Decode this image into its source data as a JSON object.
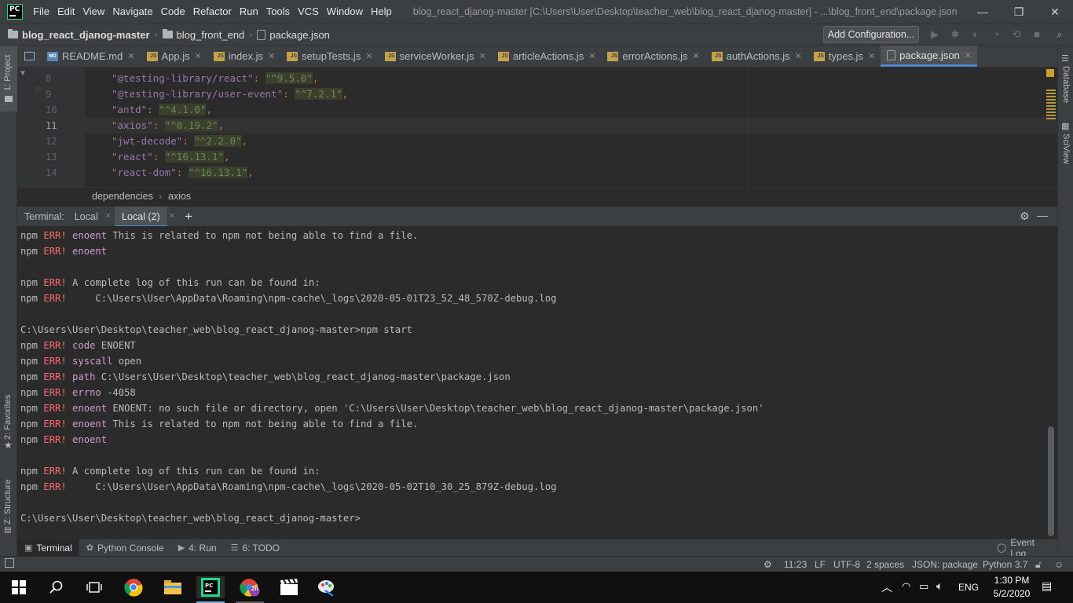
{
  "titlebar": {
    "menu": [
      "File",
      "Edit",
      "View",
      "Navigate",
      "Code",
      "Refactor",
      "Run",
      "Tools",
      "VCS",
      "Window",
      "Help"
    ],
    "window_title": "blog_react_djanog-master [C:\\Users\\User\\Desktop\\teacher_web\\blog_react_djanog-master] - ...\\blog_front_end\\package.json",
    "controls": {
      "minimize": "—",
      "restore": "❐",
      "close": "✕"
    }
  },
  "navbar": {
    "project": "blog_react_djanog-master",
    "folder": "blog_front_end",
    "file": "package.json",
    "add_config": "Add Configuration..."
  },
  "tabs": [
    {
      "label": "README.md",
      "icon": "md"
    },
    {
      "label": "App.js",
      "icon": "js"
    },
    {
      "label": "index.js",
      "icon": "js"
    },
    {
      "label": "setupTests.js",
      "icon": "js"
    },
    {
      "label": "serviceWorker.js",
      "icon": "js"
    },
    {
      "label": "articleActions.js",
      "icon": "js"
    },
    {
      "label": "errorActions.js",
      "icon": "js"
    },
    {
      "label": "authActions.js",
      "icon": "js"
    },
    {
      "label": "types.js",
      "icon": "js"
    },
    {
      "label": "package.json",
      "icon": "json",
      "active": true
    }
  ],
  "left_strip": {
    "project": "1: Project",
    "favorites": "2: Favorites",
    "structure": "Z: Structure"
  },
  "right_strip": {
    "database": "Database",
    "sciview": "SciView"
  },
  "editor": {
    "lines": [
      {
        "n": "8",
        "key": "\"@testing-library/react\"",
        "val": "\"^9.5.0\""
      },
      {
        "n": "9",
        "key": "\"@testing-library/user-event\"",
        "val": "\"^7.2.1\""
      },
      {
        "n": "10",
        "key": "\"antd\"",
        "val": "\"^4.1.0\""
      },
      {
        "n": "11",
        "key": "\"axios\"",
        "val": "\"^0.19.2\""
      },
      {
        "n": "12",
        "key": "\"jwt-decode\"",
        "val": "\"^2.2.0\""
      },
      {
        "n": "13",
        "key": "\"react\"",
        "val": "\"^16.13.1\""
      },
      {
        "n": "14",
        "key": "\"react-dom\"",
        "val": "\"^16.13.1\""
      }
    ],
    "breadcrumb": [
      "dependencies",
      "axios"
    ]
  },
  "terminal": {
    "label": "Terminal:",
    "tabs": [
      "Local",
      "Local (2)"
    ],
    "add": "+",
    "lines": [
      {
        "p": "npm ",
        "e": "ERR!",
        "k": " enoent",
        "r": " This is related to npm not being able to find a file."
      },
      {
        "p": "npm ",
        "e": "ERR!",
        "k": " enoent",
        "r": ""
      },
      {
        "p": "",
        "e": "",
        "k": "",
        "r": ""
      },
      {
        "p": "npm ",
        "e": "ERR!",
        "k": "",
        "r": " A complete log of this run can be found in:"
      },
      {
        "p": "npm ",
        "e": "ERR!",
        "k": "",
        "r": "     C:\\Users\\User\\AppData\\Roaming\\npm-cache\\_logs\\2020-05-01T23_52_48_570Z-debug.log"
      },
      {
        "p": "",
        "e": "",
        "k": "",
        "r": ""
      },
      {
        "p": "C:\\Users\\User\\Desktop\\teacher_web\\blog_react_djanog-master>npm start",
        "e": "",
        "k": "",
        "r": ""
      },
      {
        "p": "npm ",
        "e": "ERR!",
        "k": " code",
        "r": " ENOENT"
      },
      {
        "p": "npm ",
        "e": "ERR!",
        "k": " syscall",
        "r": " open"
      },
      {
        "p": "npm ",
        "e": "ERR!",
        "k": " path",
        "r": " C:\\Users\\User\\Desktop\\teacher_web\\blog_react_djanog-master\\package.json"
      },
      {
        "p": "npm ",
        "e": "ERR!",
        "k": " errno",
        "r": " -4058"
      },
      {
        "p": "npm ",
        "e": "ERR!",
        "k": " enoent",
        "r": " ENOENT: no such file or directory, open 'C:\\Users\\User\\Desktop\\teacher_web\\blog_react_djanog-master\\package.json'"
      },
      {
        "p": "npm ",
        "e": "ERR!",
        "k": " enoent",
        "r": " This is related to npm not being able to find a file."
      },
      {
        "p": "npm ",
        "e": "ERR!",
        "k": " enoent",
        "r": ""
      },
      {
        "p": "",
        "e": "",
        "k": "",
        "r": ""
      },
      {
        "p": "npm ",
        "e": "ERR!",
        "k": "",
        "r": " A complete log of this run can be found in:"
      },
      {
        "p": "npm ",
        "e": "ERR!",
        "k": "",
        "r": "     C:\\Users\\User\\AppData\\Roaming\\npm-cache\\_logs\\2020-05-02T10_30_25_879Z-debug.log"
      },
      {
        "p": "",
        "e": "",
        "k": "",
        "r": ""
      },
      {
        "p": "C:\\Users\\User\\Desktop\\teacher_web\\blog_react_djanog-master>",
        "e": "",
        "k": "",
        "r": ""
      }
    ]
  },
  "tool_windows": [
    {
      "label": "Terminal",
      "active": true
    },
    {
      "label": "Python Console"
    },
    {
      "label": "4: Run"
    },
    {
      "label": "6: TODO"
    }
  ],
  "event_log": "Event Log",
  "status": {
    "position": "11:23",
    "line_sep": "LF",
    "encoding": "UTF-8",
    "indent": "2 spaces",
    "schema": "JSON: package",
    "interpreter": "Python 3.7"
  },
  "taskbar": {
    "lang": "ENG",
    "time": "1:30 PM",
    "date": "5/2/2020",
    "chrome_badge": "Zh"
  },
  "colors": {
    "error": "#ff6b68",
    "keyword": "#d39bd2",
    "accent": "#4a88c7"
  }
}
